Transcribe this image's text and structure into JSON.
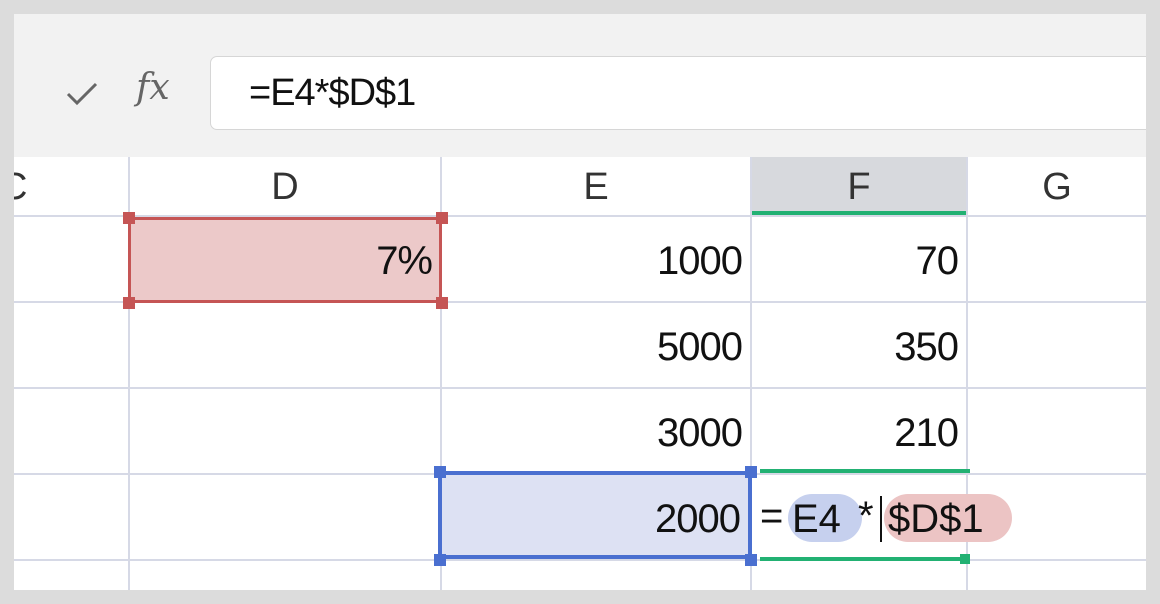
{
  "formula_bar": {
    "check_icon": "checkmark-icon",
    "fx_label": "fx",
    "formula": "=E4*$D$1"
  },
  "columns": [
    "C",
    "D",
    "E",
    "F",
    "G"
  ],
  "selected_column": "F",
  "cells": {
    "D1": "7%",
    "E1": "1000",
    "F1": "70",
    "E2": "5000",
    "F2": "350",
    "E3": "3000",
    "F3": "210",
    "E4": "2000"
  },
  "editor": {
    "equals": "=",
    "ref1": "E4",
    "operator": "*",
    "ref2": "$D$1"
  },
  "colors": {
    "ref1_highlight": "#4a6fd0",
    "ref2_highlight": "#c55555",
    "active_cell": "#22b173"
  }
}
